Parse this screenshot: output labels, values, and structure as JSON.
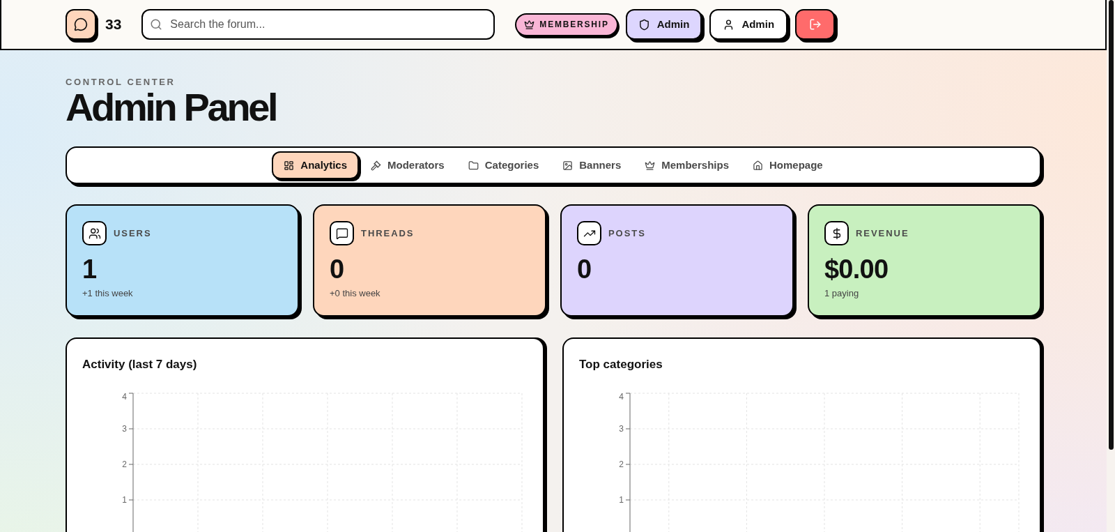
{
  "header": {
    "brand": "33",
    "search": {
      "placeholder": "Search the forum..."
    },
    "buttons": [
      {
        "kind": "membership",
        "label": "MEMBERSHIP"
      },
      {
        "kind": "admin",
        "label": "Admin"
      },
      {
        "kind": "profile",
        "label": "Admin"
      },
      {
        "kind": "logout"
      }
    ]
  },
  "page": {
    "eyebrow": "CONTROL CENTER",
    "title": "Admin Panel"
  },
  "tabs": [
    {
      "label": "Analytics",
      "selected": true
    },
    {
      "label": "Moderators",
      "selected": false
    },
    {
      "label": "Categories",
      "selected": false
    },
    {
      "label": "Banners",
      "selected": false
    },
    {
      "label": "Memberships",
      "selected": false
    },
    {
      "label": "Homepage",
      "selected": false
    }
  ],
  "stats": [
    {
      "label": "USERS",
      "value": "1",
      "note": "+1 this week"
    },
    {
      "label": "THREADS",
      "value": "0",
      "note": "+0 this week"
    },
    {
      "label": "POSTS",
      "value": "0"
    },
    {
      "label": "REVENUE",
      "value": "$0.00",
      "note": "1 paying"
    }
  ],
  "charts": [
    {
      "kind": "line",
      "title": "Activity (last 7 days)",
      "y_ticks": [
        "4",
        "3",
        "2",
        "1"
      ]
    },
    {
      "kind": "bar",
      "title": "Top categories",
      "y_ticks": [
        "4",
        "3",
        "2",
        "1"
      ]
    }
  ]
}
